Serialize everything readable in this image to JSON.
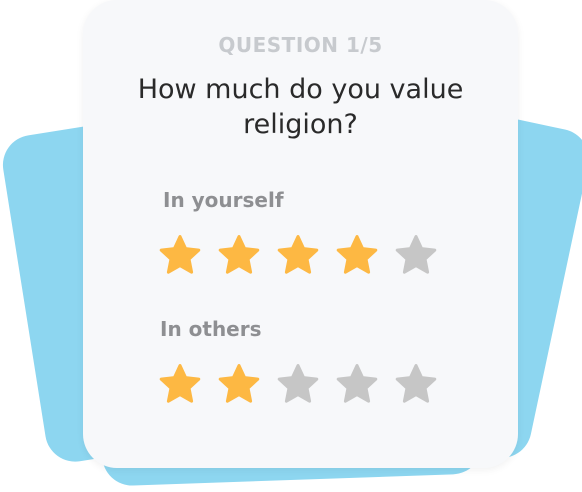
{
  "quiz": {
    "question_number": "QUESTION 1/5",
    "question_text": "How much do you value religion?"
  },
  "ratings": [
    {
      "label": "In yourself",
      "value": 4,
      "max": 5
    },
    {
      "label": "In others",
      "value": 2,
      "max": 5
    }
  ],
  "colors": {
    "back_card": "#8dd6f0",
    "card_background": "#f7f8fa",
    "star_filled": "#fdb843",
    "star_empty": "#c6c6c6",
    "question_number": "#c7cace",
    "label": "#8e8f92"
  },
  "icons": {
    "rating": "star-icon"
  }
}
